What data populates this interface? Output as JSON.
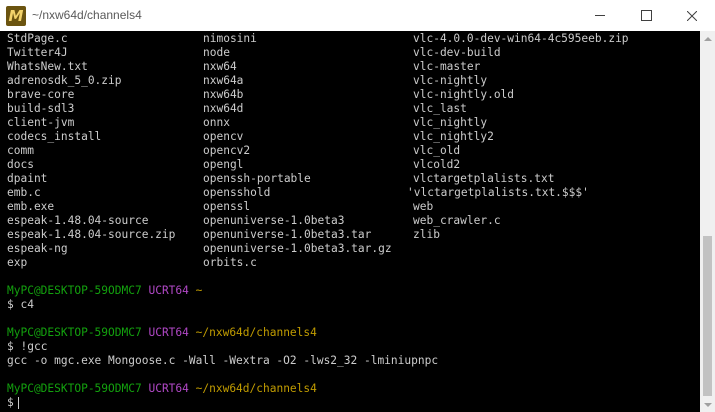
{
  "window": {
    "title": "~/nxw64d/channels4",
    "app_icon_letter": "M",
    "icon_color": "#6b5410",
    "icon_letter_color": "#f3d36b"
  },
  "colors": {
    "prompt_user": "#13a10e",
    "prompt_env": "#b148c6",
    "prompt_path": "#c19c00",
    "text": "#cccccc",
    "background": "#000000"
  },
  "listing": [
    [
      "StdPage.c",
      "nimosini",
      "vlc-4.0.0-dev-win64-4c595eeb.zip"
    ],
    [
      "Twitter4J",
      "node",
      "vlc-dev-build"
    ],
    [
      "WhatsNew.txt",
      "nxw64",
      "vlc-master"
    ],
    [
      "adrenosdk_5_0.zip",
      "nxw64a",
      "vlc-nightly"
    ],
    [
      "brave-core",
      "nxw64b",
      "vlc-nightly.old"
    ],
    [
      "build-sdl3",
      "nxw64d",
      "vlc_last"
    ],
    [
      "client-jvm",
      "onnx",
      "vlc_nightly"
    ],
    [
      "codecs_install",
      "opencv",
      "vlc_nightly2"
    ],
    [
      "comm",
      "opencv2",
      "vlc_old"
    ],
    [
      "docs",
      "opengl",
      "vlcold2"
    ],
    [
      "dpaint",
      "openssh-portable",
      "vlctargetplalists.txt"
    ],
    [
      "emb.c",
      "opensshold",
      "'vlctargetplalists.txt.$$$'"
    ],
    [
      "emb.exe",
      "openssl",
      "web"
    ],
    [
      "espeak-1.48.04-source",
      "openuniverse-1.0beta3",
      "web_crawler.c"
    ],
    [
      "espeak-1.48.04-source.zip",
      "openuniverse-1.0beta3.tar",
      "zlib"
    ],
    [
      "espeak-ng",
      "openuniverse-1.0beta3.tar.gz",
      ""
    ],
    [
      "exp",
      "orbits.c",
      ""
    ]
  ],
  "session": [
    {
      "user": "MyPC@DESKTOP-59ODMC7",
      "env": "UCRT64",
      "path": "~",
      "command": "c4"
    },
    {
      "user": "MyPC@DESKTOP-59ODMC7",
      "env": "UCRT64",
      "path": "~/nxw64d/channels4",
      "command": "!gcc",
      "output": "gcc -o mgc.exe Mongoose.c -Wall -Wextra -O2 -lws2_32 -lminiupnpc"
    },
    {
      "user": "MyPC@DESKTOP-59ODMC7",
      "env": "UCRT64",
      "path": "~/nxw64d/channels4",
      "command": ""
    }
  ],
  "prompt_symbol": "$"
}
